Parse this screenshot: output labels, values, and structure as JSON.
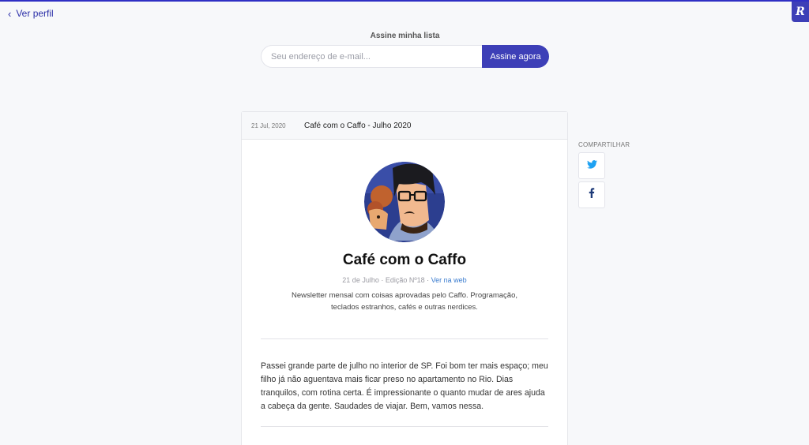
{
  "nav": {
    "back_label": "Ver perfil"
  },
  "brand": {
    "badge_letter": "R",
    "color": "#3d3fb7"
  },
  "subscribe": {
    "label": "Assine minha lista",
    "email_placeholder": "Seu endereço de e-mail...",
    "button_label": "Assine agora"
  },
  "issue": {
    "date": "21 Jul, 2020",
    "header_title": "Café com o Caffo - Julho 2020",
    "newsletter_title": "Café com o Caffo",
    "meta_text": "21 de Julho · Edição Nº18 · ",
    "web_link": "Ver na web",
    "description": "Newsletter mensal com coisas aprovadas pelo Caffo. Programação, teclados estranhos, cafés e outras nerdices.",
    "body": "Passei grande parte de julho no interior de SP. Foi bom ter mais espaço; meu filho já não aguentava mais ficar preso no apartamento no Rio. Dias tranquilos, com rotina certa. É impressionante o quanto mudar de ares ajuda a cabeça da gente. Saudades de viajar. Bem, vamos nessa."
  },
  "share": {
    "label": "COMPARTILHAR",
    "buttons": [
      {
        "icon": "twitter-icon",
        "color": "#1da1f2"
      },
      {
        "icon": "facebook-icon",
        "color": "#1d3a78"
      }
    ]
  }
}
